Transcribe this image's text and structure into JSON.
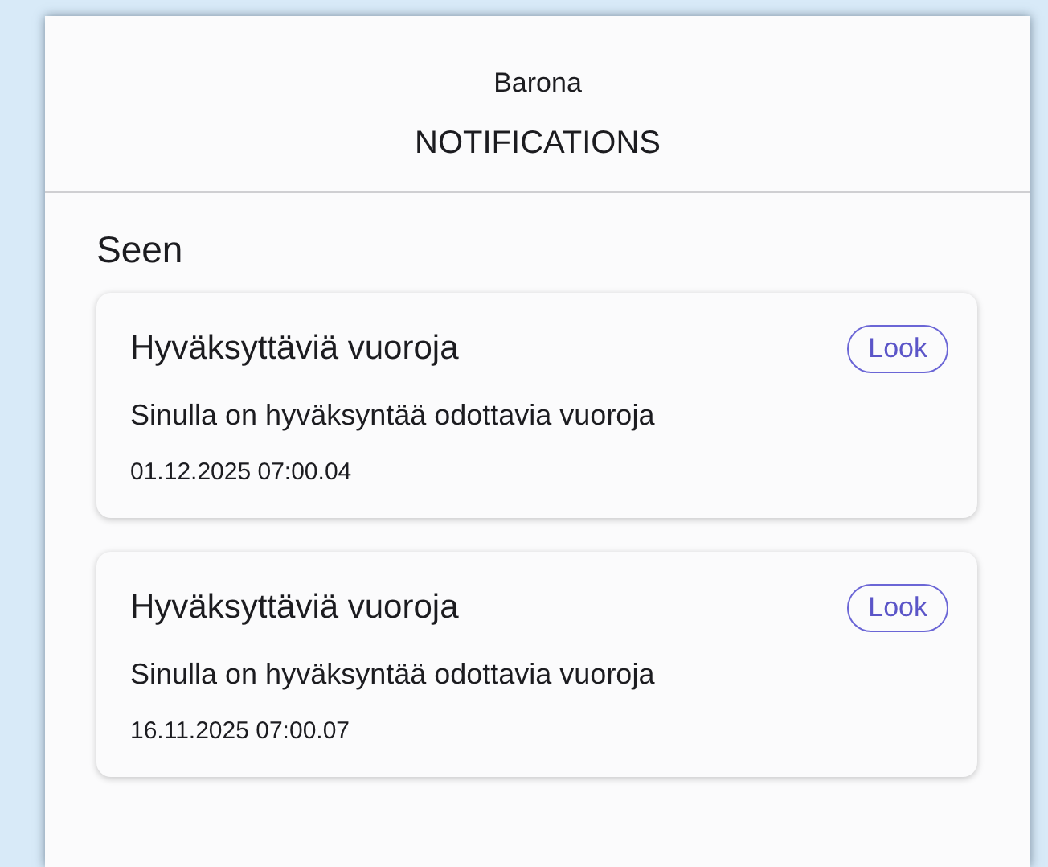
{
  "header": {
    "app_name": "Barona",
    "title": "NOTIFICATIONS"
  },
  "section": {
    "title": "Seen"
  },
  "notifications": [
    {
      "title": "Hyväksyttäviä vuoroja",
      "action": "Look",
      "message": "Sinulla on hyväksyntää odottavia vuoroja",
      "timestamp": "01.12.2025 07:00.04"
    },
    {
      "title": "Hyväksyttäviä vuoroja",
      "action": "Look",
      "message": "Sinulla on hyväksyntää odottavia vuoroja",
      "timestamp": "16.11.2025 07:00.07"
    }
  ]
}
